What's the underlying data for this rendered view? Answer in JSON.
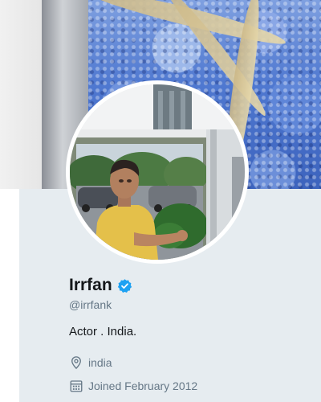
{
  "profile": {
    "display_name": "Irrfan",
    "handle": "@irrfank",
    "bio": "Actor . India.",
    "location": "india",
    "joined": "Joined February 2012",
    "verified": true
  },
  "icons": {
    "verified": "verified-badge-icon",
    "location": "location-pin-icon",
    "joined": "calendar-icon"
  },
  "colors": {
    "verified_blue": "#1da1f2",
    "card_background": "#e6ecf0",
    "secondary_text": "#657786",
    "primary_text": "#14171a"
  }
}
